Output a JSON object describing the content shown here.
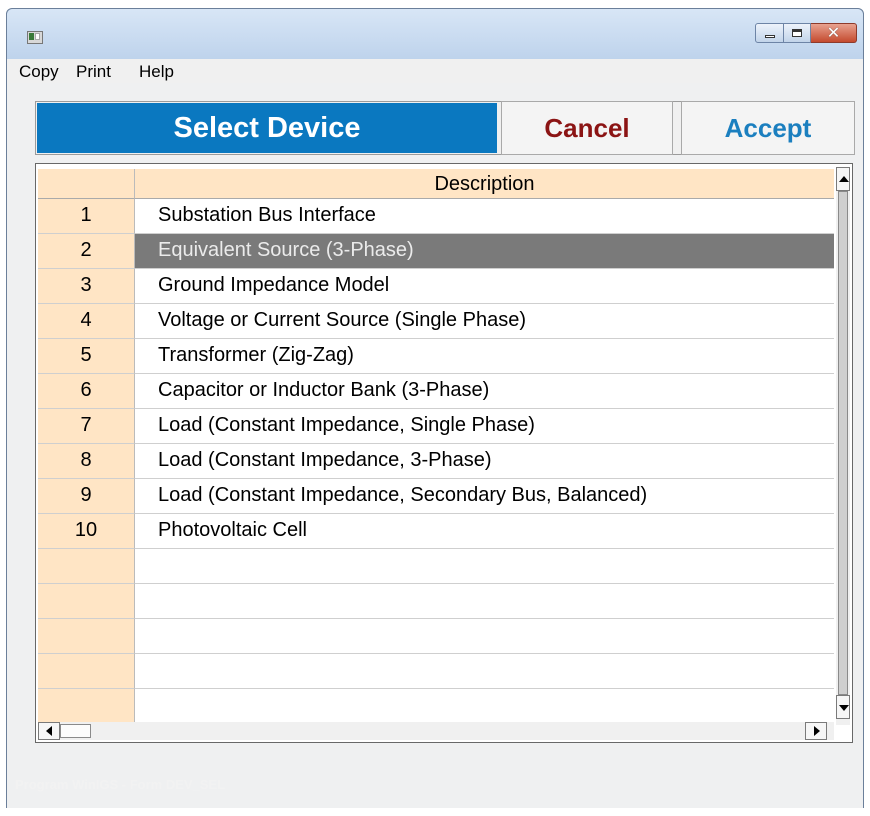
{
  "window": {
    "title": "",
    "close_glyph": "✕"
  },
  "menu": {
    "items": [
      "Copy",
      "Print",
      "Help"
    ]
  },
  "header": {
    "title": "Select Device",
    "cancel_label": "Cancel",
    "accept_label": "Accept"
  },
  "grid": {
    "columns": [
      "",
      "Description"
    ],
    "rows": [
      {
        "num": "1",
        "description": "Substation Bus Interface",
        "selected": false
      },
      {
        "num": "2",
        "description": "Equivalent Source (3-Phase)",
        "selected": true
      },
      {
        "num": "3",
        "description": "Ground Impedance Model",
        "selected": false
      },
      {
        "num": "4",
        "description": "Voltage or Current Source (Single Phase)",
        "selected": false
      },
      {
        "num": "5",
        "description": "Transformer (Zig-Zag)",
        "selected": false
      },
      {
        "num": "6",
        "description": "Capacitor or Inductor Bank (3-Phase)",
        "selected": false
      },
      {
        "num": "7",
        "description": "Load (Constant Impedance, Single Phase)",
        "selected": false
      },
      {
        "num": "8",
        "description": "Load (Constant Impedance, 3-Phase)",
        "selected": false
      },
      {
        "num": "9",
        "description": "Load (Constant Impedance, Secondary Bus, Balanced)",
        "selected": false
      },
      {
        "num": "10",
        "description": "Photovoltaic Cell",
        "selected": false
      },
      {
        "num": "",
        "description": "",
        "selected": false
      },
      {
        "num": "",
        "description": "",
        "selected": false
      },
      {
        "num": "",
        "description": "",
        "selected": false
      },
      {
        "num": "",
        "description": "",
        "selected": false
      },
      {
        "num": "",
        "description": "",
        "selected": false
      }
    ]
  },
  "status": {
    "text": "Program WinIGS - Form DEV_SEL"
  },
  "colors": {
    "title_bg": "#0a78c0",
    "cancel_text": "#8b1414",
    "accept_text": "#1b7fbf",
    "number_col_bg": "#ffe5c5",
    "selected_row_bg": "#7a7a7a"
  },
  "icons": [
    "app-icon",
    "minimize-icon",
    "maximize-icon",
    "close-icon",
    "scroll-up-icon",
    "scroll-down-icon",
    "scroll-left-icon",
    "scroll-right-icon"
  ]
}
